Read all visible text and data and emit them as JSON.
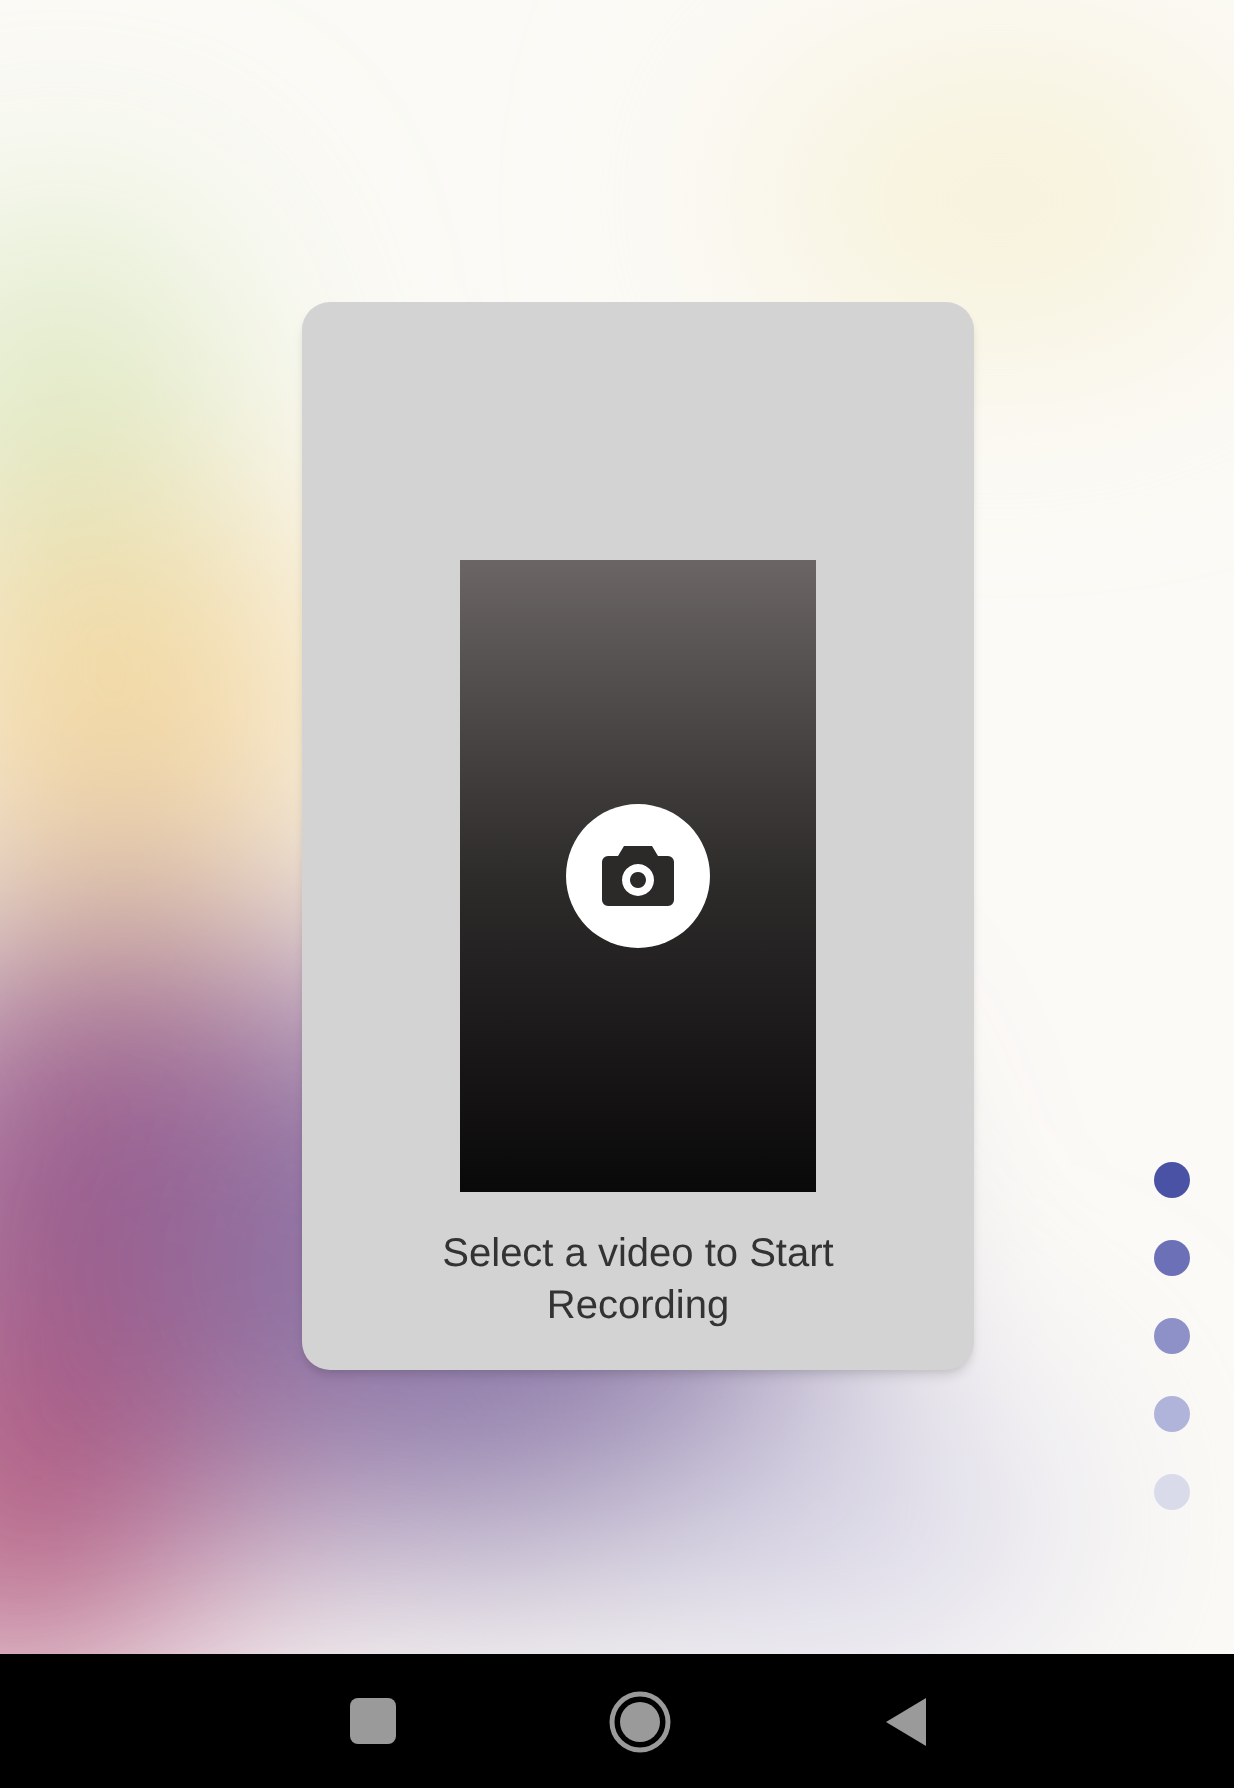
{
  "card": {
    "message": "Select a video to Start Recording"
  },
  "page_indicator": [
    {
      "color": "#4a52a6"
    },
    {
      "color": "#6c70b6"
    },
    {
      "color": "#8d91c7"
    },
    {
      "color": "#b1b4da"
    },
    {
      "color": "#d9dbeb"
    }
  ]
}
